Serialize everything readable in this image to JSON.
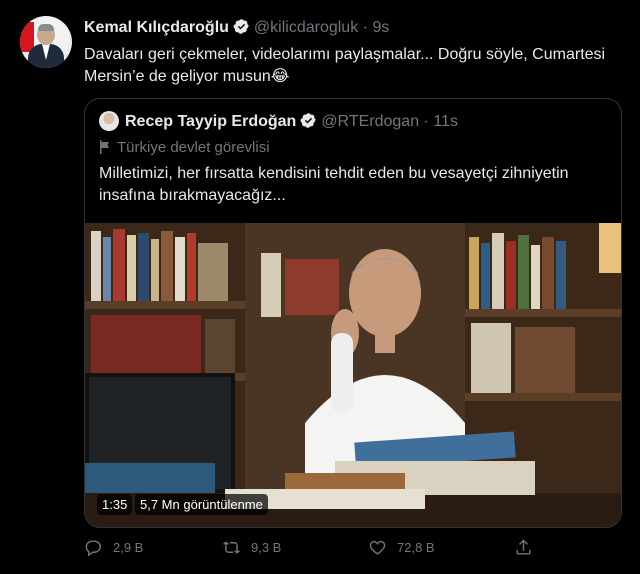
{
  "tweet": {
    "author_name": "Kemal Kılıçdaroğlu",
    "author_handle": "@kilicdarogluk",
    "separator": "·",
    "time": "9s",
    "text": "Davaları geri çekmeler, videolarımı paylaşmalar... Doğru söyle, Cumartesi Mersin’e de geliyor musun😂"
  },
  "quoted": {
    "author_name": "Recep Tayyip Erdoğan",
    "author_handle": "@RTErdogan",
    "separator": "·",
    "time": "11s",
    "label": "Türkiye devlet görevlisi",
    "text": "Milletimizi, her fırsatta kendisini tehdit eden bu vesayetçi zihniyetin insafına bırakmayacağız...",
    "video": {
      "duration": "1:35",
      "views": "5,7 Mn görüntülenme"
    }
  },
  "actions": {
    "reply_count": "2,9 B",
    "retweet_count": "9,3 B",
    "like_count": "72,8 B"
  },
  "icons": [
    "verified-icon",
    "reply-icon",
    "retweet-icon",
    "like-icon",
    "share-icon",
    "flag-icon"
  ],
  "colors": {
    "background": "#000000",
    "text": "#e7e9ea",
    "muted": "#71767b",
    "verified": "#1d9bf0",
    "border": "#2f3336"
  }
}
